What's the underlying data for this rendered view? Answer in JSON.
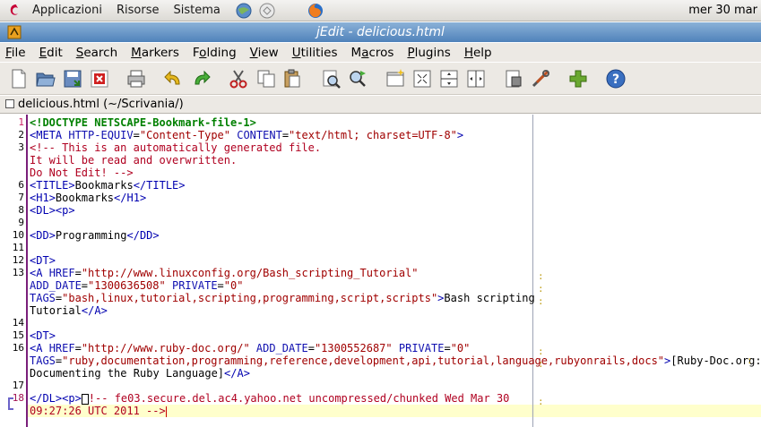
{
  "panel": {
    "applications": "Applicazioni",
    "places": "Risorse",
    "system": "Sistema",
    "clock": "mer 30 mar"
  },
  "window": {
    "title": "jEdit - delicious.html"
  },
  "menu": [
    "File",
    "Edit",
    "Search",
    "Markers",
    "Folding",
    "View",
    "Utilities",
    "Macros",
    "Plugins",
    "Help"
  ],
  "menu_underline": [
    "F",
    "E",
    "S",
    "M",
    "o",
    "V",
    "U",
    "a",
    "P",
    "H"
  ],
  "buffer": {
    "label": "delicious.html (~/Scrivania/)"
  },
  "editor": {
    "lines": [
      {
        "n": "1",
        "row": 0,
        "text": "<!DOCTYPE NETSCAPE-Bookmark-file-1>"
      },
      {
        "n": "2",
        "row": 1,
        "text": "<META HTTP-EQUIV=\"Content-Type\" CONTENT=\"text/html; charset=UTF-8\">"
      },
      {
        "n": "3",
        "row": 2,
        "text": "<!-- This is an automatically generated file."
      },
      {
        "n": "",
        "row": 3,
        "text": "It will be read and overwritten."
      },
      {
        "n": "",
        "row": 4,
        "text": "Do Not Edit! -->"
      },
      {
        "n": "6",
        "row": 5,
        "text": "<TITLE>Bookmarks</TITLE>"
      },
      {
        "n": "7",
        "row": 6,
        "text": "<H1>Bookmarks</H1>"
      },
      {
        "n": "8",
        "row": 7,
        "text": "<DL><p>"
      },
      {
        "n": "9",
        "row": 8,
        "text": ""
      },
      {
        "n": "10",
        "row": 9,
        "text": "<DD>Programming</DD>"
      },
      {
        "n": "11",
        "row": 10,
        "text": ""
      },
      {
        "n": "12",
        "row": 11,
        "text": "<DT>"
      },
      {
        "n": "13",
        "row": 12,
        "text": "<A HREF=\"http://www.linuxconfig.org/Bash_scripting_Tutorial\""
      },
      {
        "n": "",
        "row": 13,
        "text": "ADD_DATE=\"1300636508\" PRIVATE=\"0\""
      },
      {
        "n": "",
        "row": 14,
        "text": "TAGS=\"bash,linux,tutorial,scripting,programming,script,scripts\">Bash scripting"
      },
      {
        "n": "",
        "row": 15,
        "text": "Tutorial</A>"
      },
      {
        "n": "14",
        "row": 16,
        "text": ""
      },
      {
        "n": "15",
        "row": 17,
        "text": "<DT>"
      },
      {
        "n": "16",
        "row": 18,
        "text": "<A HREF=\"http://www.ruby-doc.org/\" ADD_DATE=\"1300552687\" PRIVATE=\"0\""
      },
      {
        "n": "",
        "row": 19,
        "text": "TAGS=\"ruby,documentation,programming,reference,development,api,tutorial,language,rubyonrails,docs\">[Ruby-Doc.org:"
      },
      {
        "n": "",
        "row": 20,
        "text": "Documenting the Ruby Language]</A>"
      },
      {
        "n": "17",
        "row": 21,
        "text": ""
      },
      {
        "n": "18",
        "row": 22,
        "text": "</DL><p><!-- fe03.secure.del.ac4.yahoo.net uncompressed/chunked Wed Mar 30"
      },
      {
        "n": "",
        "row": 23,
        "text": "09:27:26 UTC 2011 -->"
      }
    ]
  },
  "icons": [
    "new-file-icon",
    "open-file-icon",
    "save-file-icon",
    "close-file-icon",
    "print-icon",
    "undo-icon",
    "redo-icon",
    "cut-icon",
    "copy-icon",
    "paste-icon",
    "find-icon",
    "find-next-icon",
    "new-view-icon",
    "unsplit-icon",
    "split-horizontal-icon",
    "split-vertical-icon",
    "buffer-options-icon",
    "global-options-icon",
    "plugin-manager-icon",
    "help-icon"
  ]
}
